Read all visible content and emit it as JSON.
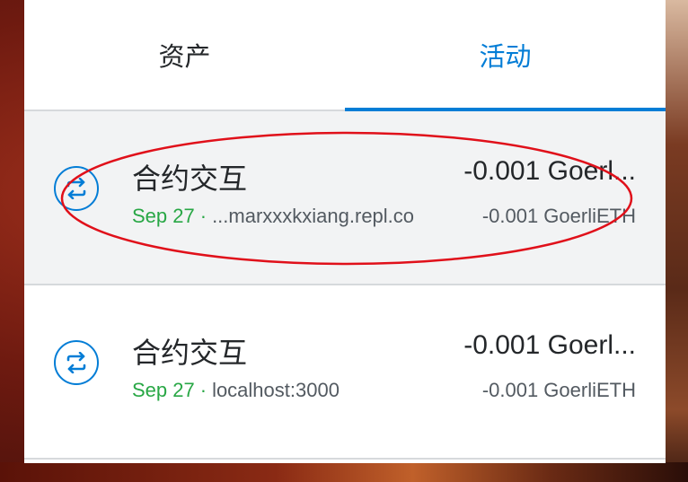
{
  "tabs": [
    {
      "label": "资产",
      "active": false
    },
    {
      "label": "活动",
      "active": true
    }
  ],
  "transactions": [
    {
      "icon": "swap-arrows-icon",
      "title": "合约交互",
      "date": "Sep 27",
      "separator": "·",
      "origin": "...marxxxkxiang.repl.co",
      "amount": "-0.001 GoerliETH",
      "amount_display": "-0.001 Goerl...",
      "amount_secondary": "-0.001 GoerliETH"
    },
    {
      "icon": "swap-arrows-icon",
      "title": "合约交互",
      "date": "Sep 27",
      "separator": "·",
      "origin": "localhost:3000",
      "amount": "-0.001 GoerliETH",
      "amount_display": "-0.001 Goerl...",
      "amount_secondary": "-0.001 GoerliETH"
    }
  ],
  "colors": {
    "accent": "#037dd6",
    "date_green": "#28a745",
    "annotation_red": "#e0101a"
  }
}
